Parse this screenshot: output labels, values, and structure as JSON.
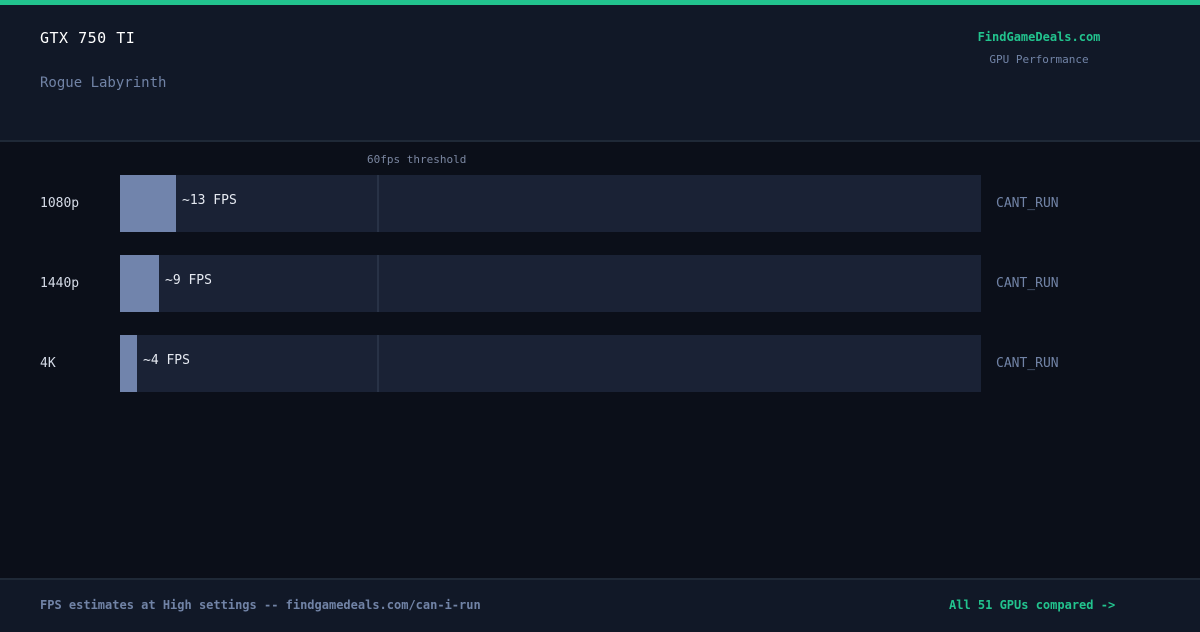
{
  "header": {
    "gpu": "GTX 750 TI",
    "game": "Rogue Labyrinth",
    "brand": "FindGameDeals.com",
    "subtitle": "GPU Performance"
  },
  "chart_data": {
    "type": "bar",
    "orientation": "horizontal",
    "threshold": {
      "value": 60,
      "label": "60fps threshold"
    },
    "xlim": [
      0,
      200
    ],
    "categories": [
      "1080p",
      "1440p",
      "4K"
    ],
    "values": [
      13,
      9,
      4
    ],
    "value_labels": [
      "~13 FPS",
      "~9 FPS",
      "~4 FPS"
    ],
    "status": [
      "CANT_RUN",
      "CANT_RUN",
      "CANT_RUN"
    ]
  },
  "colors": {
    "accent": "#22c38e",
    "bar_fill": "#7184ac",
    "track": "#1a2235",
    "background": "#0b0f19"
  },
  "footer": {
    "note": "FPS estimates at High settings -- findgamedeals.com/can-i-run",
    "link": "All 51 GPUs compared ->"
  }
}
